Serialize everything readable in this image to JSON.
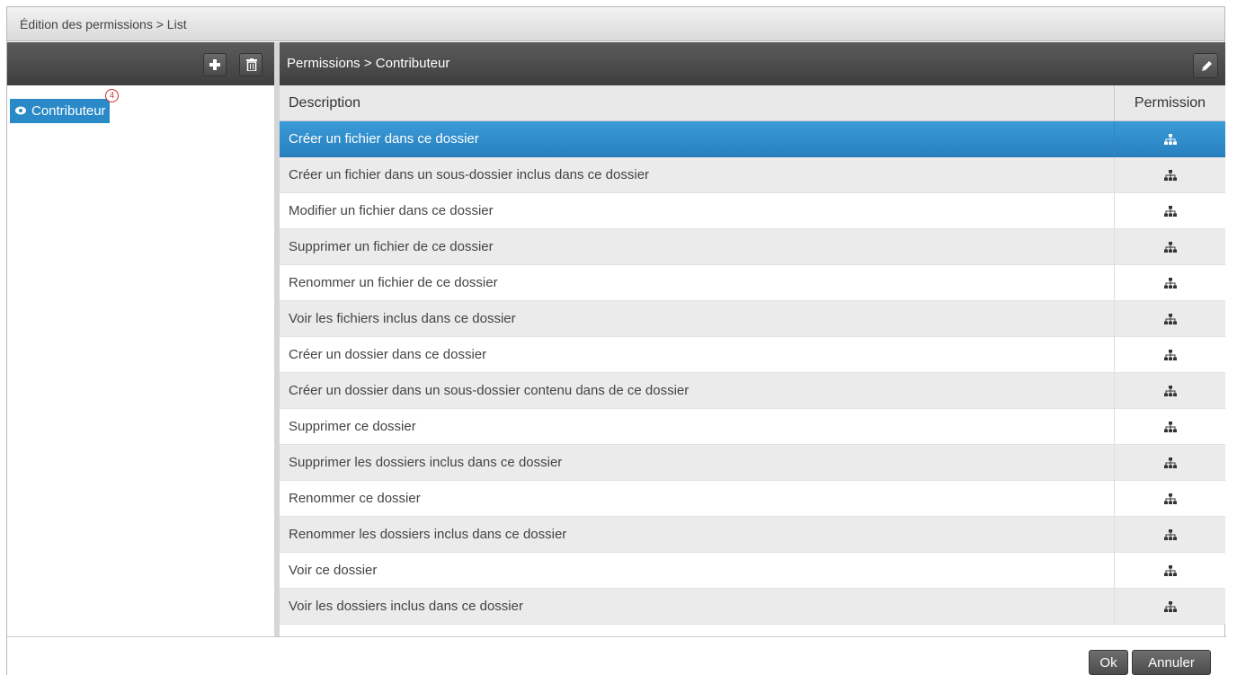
{
  "window": {
    "title": "Édition des permissions > List"
  },
  "left_toolbar": {
    "add_icon": "plus-icon",
    "delete_icon": "trash-icon"
  },
  "roles": [
    {
      "label": "Contributeur",
      "icon": "role-icon",
      "badge": "4",
      "selected": true
    }
  ],
  "right_header": {
    "title": "Permissions > Contributeur",
    "edit_icon": "pencil-icon"
  },
  "table": {
    "columns": [
      "Description",
      "Permission"
    ],
    "rows": [
      {
        "description": "Créer un fichier dans ce dossier",
        "permission_icon": "hierarchy-icon",
        "selected": true
      },
      {
        "description": "Créer un fichier dans un sous-dossier inclus dans ce dossier",
        "permission_icon": "hierarchy-icon"
      },
      {
        "description": "Modifier un fichier dans ce dossier",
        "permission_icon": "hierarchy-icon"
      },
      {
        "description": "Supprimer un fichier de ce dossier",
        "permission_icon": "hierarchy-icon"
      },
      {
        "description": "Renommer un fichier de ce dossier",
        "permission_icon": "hierarchy-icon"
      },
      {
        "description": "Voir les fichiers inclus dans ce dossier",
        "permission_icon": "hierarchy-icon"
      },
      {
        "description": "Créer un dossier dans ce dossier",
        "permission_icon": "hierarchy-icon"
      },
      {
        "description": "Créer un dossier dans un sous-dossier contenu dans de ce dossier",
        "permission_icon": "hierarchy-icon"
      },
      {
        "description": "Supprimer ce dossier",
        "permission_icon": "hierarchy-icon"
      },
      {
        "description": "Supprimer les dossiers inclus dans ce dossier",
        "permission_icon": "hierarchy-icon"
      },
      {
        "description": "Renommer ce dossier",
        "permission_icon": "hierarchy-icon"
      },
      {
        "description": "Renommer les dossiers inclus dans ce dossier",
        "permission_icon": "hierarchy-icon"
      },
      {
        "description": "Voir ce dossier",
        "permission_icon": "hierarchy-icon"
      },
      {
        "description": "Voir les dossiers inclus dans ce dossier",
        "permission_icon": "hierarchy-icon"
      }
    ]
  },
  "footer": {
    "ok_label": "Ok",
    "cancel_label": "Annuler"
  },
  "colors": {
    "selection": "#2a8ac8",
    "toolbar": "#4a4a4a",
    "badge": "#d32b2b"
  }
}
